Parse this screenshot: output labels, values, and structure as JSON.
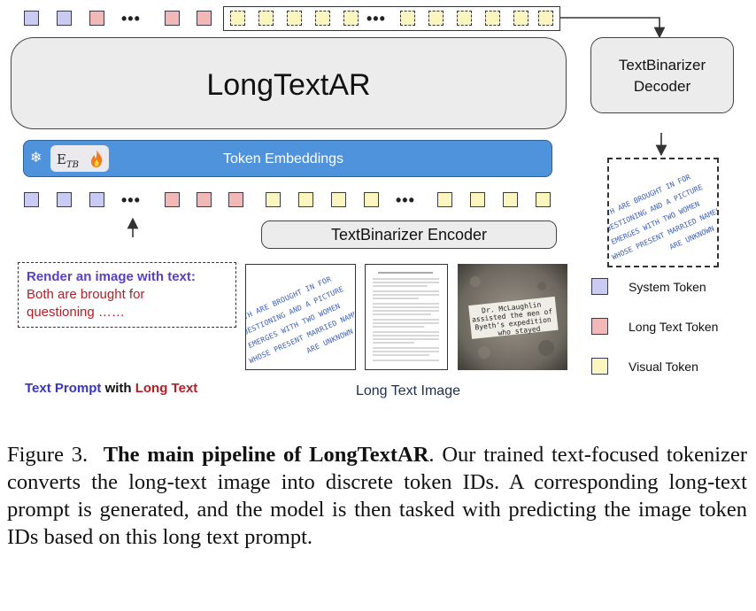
{
  "figure": {
    "ar_title": "LongTextAR",
    "decoder_line1": "TextBinarizer",
    "decoder_line2": "Decoder",
    "embeddings_label": "Token Embeddings",
    "etb_label": "E",
    "etb_sub": "TB",
    "encoder_label": "TextBinarizer Encoder",
    "prompt_title": "Render an image with text:",
    "prompt_line1": "Both are brought for",
    "prompt_line2": "questioning ……",
    "caption_text_prompt": "Text Prompt",
    "caption_with": " with ",
    "caption_long_text": "Long Text",
    "caption_long_text_image": "Long Text Image",
    "ellipsis": "•••",
    "handwriting_lines": [
      "BOTH ARE BROUGHT IN FOR",
      "QUESTIONING AND A PICTURE",
      "EMERGES WITH TWO WOMEN",
      "WHOSE PRESENT MARRIED NAMES",
      "ARE UNKNOWN"
    ],
    "photo_note_lines": [
      "Dr. McLaughlin",
      "assisted the men of",
      "Byeth's expedition",
      "who stayed"
    ]
  },
  "legend": {
    "system_token": "System Token",
    "long_text_token": "Long Text Token",
    "visual_token": "Visual Token"
  },
  "caption": {
    "prefix": "Figure 3.",
    "bold": "The main pipeline of LongTextAR",
    "rest": ". Our trained text-focused tokenizer converts the long-text image into discrete token IDs. A corresponding long-text prompt is generated, and the model is then tasked with predicting the image token IDs based on this long text prompt."
  },
  "colors": {
    "system_token": "#c9cbf2",
    "long_text_token": "#f2b8b6",
    "visual_token": "#fbf5bf",
    "embedding_bar": "#4f93dd",
    "prompt_title": "#5a3fc8",
    "long_text_red": "#b51d24"
  }
}
